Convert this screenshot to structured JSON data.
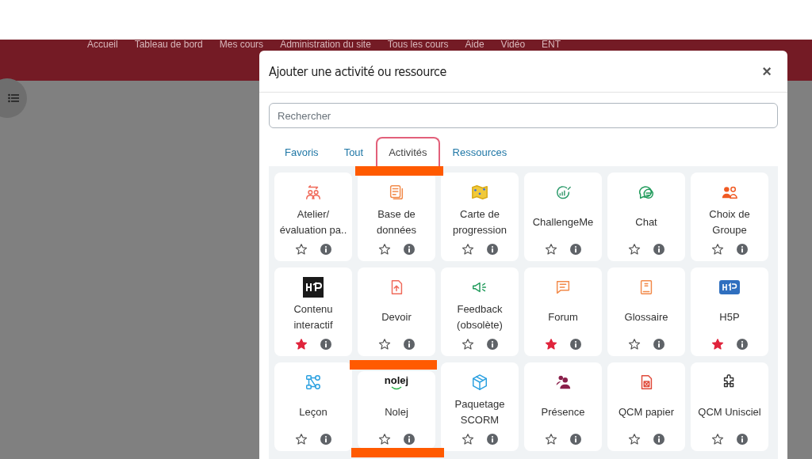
{
  "nav": {
    "items": [
      "Accueil",
      "Tableau de bord",
      "Mes cours",
      "Administration du site",
      "Tous les cours",
      "Aide",
      "Vidéo",
      "ENT"
    ]
  },
  "modal": {
    "title": "Ajouter une activité ou ressource",
    "close": "×",
    "search": {
      "placeholder": "Rechercher"
    },
    "tabs": [
      {
        "label": "Favoris",
        "selected": false
      },
      {
        "label": "Tout",
        "selected": false
      },
      {
        "label": "Activités",
        "selected": true
      },
      {
        "label": "Ressources",
        "selected": false
      }
    ],
    "activities": [
      {
        "name": "Atelier/ évaluation pa..",
        "starred": false
      },
      {
        "name": "Base de données",
        "starred": false
      },
      {
        "name": "Carte de progression",
        "starred": false
      },
      {
        "name": "ChallengeMe",
        "starred": false
      },
      {
        "name": "Chat",
        "starred": false
      },
      {
        "name": "Choix de Groupe",
        "starred": false
      },
      {
        "name": "Contenu interactif",
        "starred": true
      },
      {
        "name": "Devoir",
        "starred": false
      },
      {
        "name": "Feedback (obsolète)",
        "starred": false
      },
      {
        "name": "Forum",
        "starred": true
      },
      {
        "name": "Glossaire",
        "starred": false
      },
      {
        "name": "H5P",
        "starred": true
      },
      {
        "name": "Leçon",
        "starred": false
      },
      {
        "name": "Nolej",
        "starred": false,
        "logo": "nolej"
      },
      {
        "name": "Paquetage SCORM",
        "starred": false
      },
      {
        "name": "Présence",
        "starred": false
      },
      {
        "name": "QCM papier",
        "starred": false
      },
      {
        "name": "QCM Unisciel",
        "starred": false
      }
    ]
  }
}
